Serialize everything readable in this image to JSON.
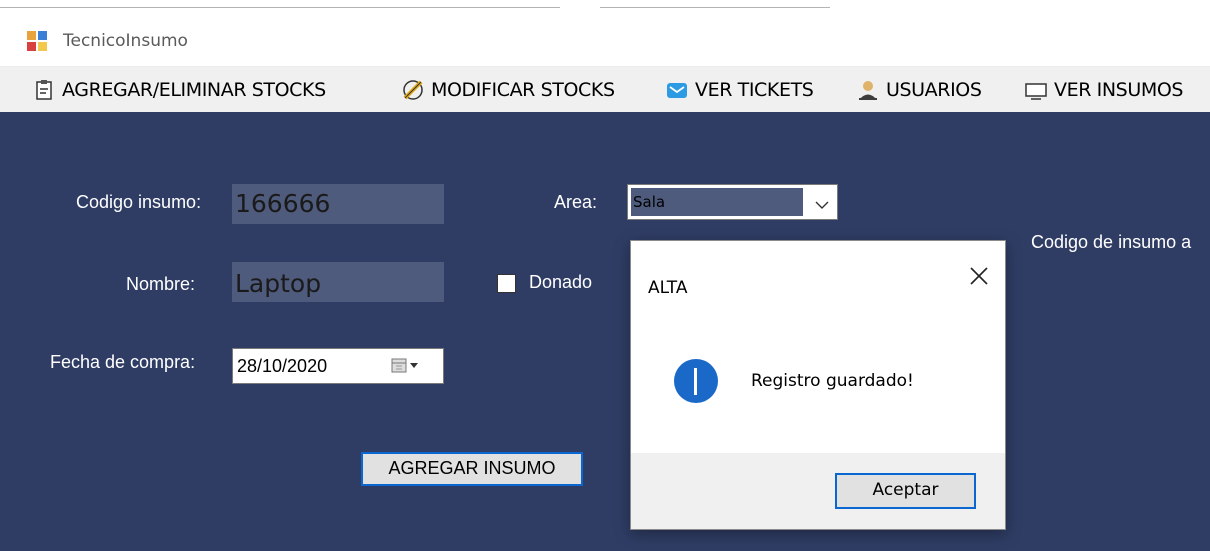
{
  "window": {
    "title": "TecnicoInsumo"
  },
  "menu": [
    {
      "label": "AGREGAR/ELIMINAR STOCKS",
      "icon": "clipboard-icon"
    },
    {
      "label": "MODIFICAR STOCKS",
      "icon": "pencil-icon"
    },
    {
      "label": "VER TICKETS",
      "icon": "envelope-icon"
    },
    {
      "label": "USUARIOS",
      "icon": "user-icon"
    },
    {
      "label": "VER INSUMOS",
      "icon": "monitor-icon"
    }
  ],
  "form": {
    "codigo_label": "Codigo insumo:",
    "codigo_value": "166666",
    "nombre_label": "Nombre:",
    "nombre_value": "Laptop",
    "fecha_label": "Fecha de compra:",
    "fecha_value": "28/10/2020",
    "area_label": "Area:",
    "area_value": "Sala",
    "donado_label": "Donado",
    "donado_checked": false,
    "side_label": "Codigo de insumo a",
    "submit_label": "AGREGAR INSUMO"
  },
  "dialog": {
    "title": "ALTA",
    "message": "Registro guardado!",
    "ok_label": "Aceptar",
    "icon": "info-icon"
  },
  "colors": {
    "panel_bg": "#2f3d65",
    "field_bg": "#4e5b7d",
    "accent": "#0a66d0",
    "info": "#1a68c8"
  }
}
